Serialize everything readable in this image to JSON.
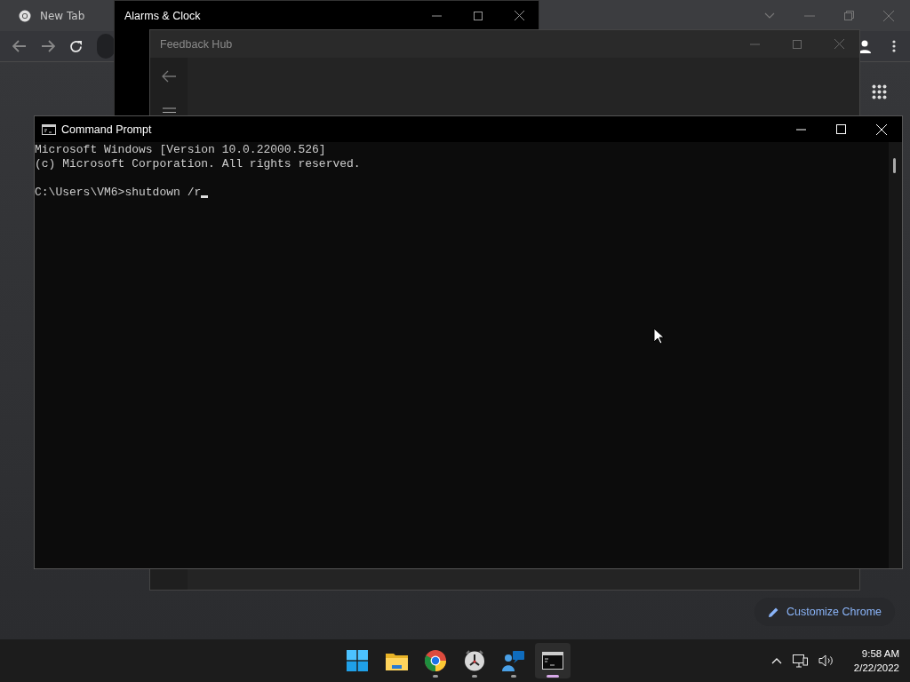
{
  "browser": {
    "tab_title": "New Tab",
    "customize_button": "Customize Chrome"
  },
  "clock_window": {
    "title": "Alarms & Clock"
  },
  "feedback_window": {
    "title": "Feedback Hub"
  },
  "console_window": {
    "title": "Command Prompt",
    "output": [
      "Microsoft Windows [Version 10.0.22000.526]",
      "(c) Microsoft Corporation. All rights reserved."
    ],
    "prompt": "C:\\Users\\VM6>shutdown /r"
  },
  "taskbar": {
    "apps": [
      {
        "kind": "start",
        "running": false,
        "selected": false
      },
      {
        "kind": "explorer",
        "running": false,
        "selected": false
      },
      {
        "kind": "chrome",
        "running": true,
        "selected": false
      },
      {
        "kind": "clock",
        "running": true,
        "selected": false
      },
      {
        "kind": "feedback",
        "running": true,
        "selected": false
      },
      {
        "kind": "terminal",
        "running": true,
        "selected": true
      }
    ],
    "time": "9:58 AM",
    "date": "2/22/2022"
  }
}
